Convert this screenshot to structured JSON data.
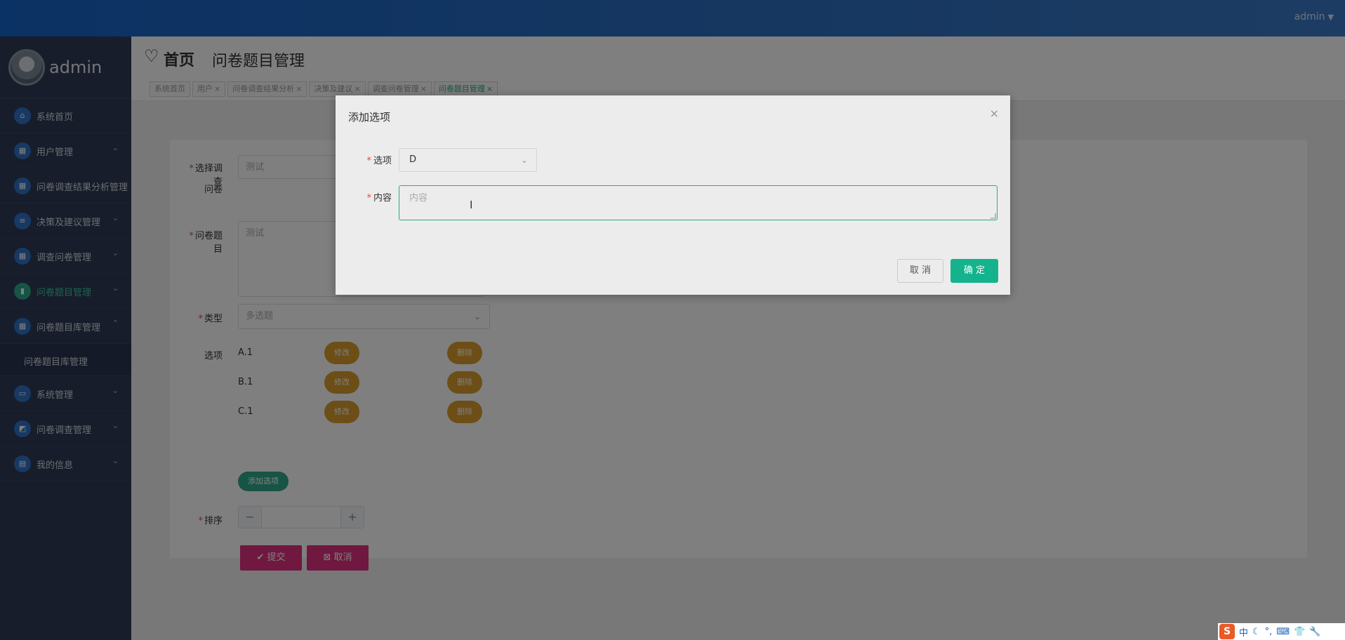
{
  "topbar": {
    "user": "admin",
    "caret": "▼"
  },
  "sidebar": {
    "brand": "admin",
    "items": [
      {
        "label": "系统首页",
        "icon": "home-icon",
        "glyph": "⌂",
        "arrow": ""
      },
      {
        "label": "用户管理",
        "icon": "grid-icon",
        "glyph": "▦",
        "arrow": "⌄"
      },
      {
        "label": "问卷调查结果分析管理",
        "icon": "grid-icon",
        "glyph": "▦",
        "arrow": ""
      },
      {
        "label": "决策及建议管理",
        "icon": "sliders-icon",
        "glyph": "≡",
        "arrow": "⌄"
      },
      {
        "label": "调查问卷管理",
        "icon": "grid-icon",
        "glyph": "▦",
        "arrow": "⌄"
      },
      {
        "label": "问卷题目管理",
        "icon": "book-icon",
        "glyph": "▮",
        "arrow": "⌄"
      },
      {
        "label": "问卷题目库管理",
        "icon": "grid-icon",
        "glyph": "▦",
        "arrow": "⌃"
      }
    ],
    "subitem": "问卷题目库管理",
    "items2": [
      {
        "label": "系统管理",
        "icon": "monitor-icon",
        "glyph": "▭",
        "arrow": "⌄"
      },
      {
        "label": "问卷调查管理",
        "icon": "inbox-icon",
        "glyph": "◩",
        "arrow": "⌄"
      },
      {
        "label": "我的信息",
        "icon": "card-icon",
        "glyph": "▤",
        "arrow": "⌄"
      }
    ]
  },
  "header": {
    "home": "首页",
    "title": "问卷题目管理",
    "tabs": [
      {
        "label": "系统首页",
        "close": ""
      },
      {
        "label": "用户",
        "close": "×"
      },
      {
        "label": "问卷调查结果分析",
        "close": "×"
      },
      {
        "label": "决策及建议",
        "close": "×"
      },
      {
        "label": "调查问卷管理",
        "close": "×"
      },
      {
        "label": "问卷题目管理",
        "close": "×"
      }
    ]
  },
  "form": {
    "survey_label_1": "选择调查",
    "survey_label_2": "问卷",
    "survey_value": "测试",
    "question_label": "问卷题目",
    "question_value": "测试",
    "type_label": "类型",
    "type_value": "多选题",
    "options_label": "选项",
    "options": [
      {
        "text": "A.1",
        "edit": "修改",
        "del": "删除"
      },
      {
        "text": "B.1",
        "edit": "修改",
        "del": "删除"
      },
      {
        "text": "C.1",
        "edit": "修改",
        "del": "删除"
      }
    ],
    "add_option": "添加选项",
    "sort_label": "排序",
    "minus": "−",
    "plus": "+",
    "submit": "✔ 提交",
    "cancel": "⊠ 取消"
  },
  "dialog": {
    "title": "添加选项",
    "close": "×",
    "option_label": "选项",
    "option_value": "D",
    "content_label": "内容",
    "content_placeholder": "内容",
    "cancel": "取 消",
    "confirm": "确 定"
  },
  "tray": [
    "中",
    "☾",
    "°,",
    "⌨",
    "👕",
    "🔧"
  ],
  "colors": {
    "accent": "#2ea88a",
    "primary": "#14b38d",
    "sidebar": "#2e3a55",
    "topbar": "#1764c9",
    "pink": "#e0307f",
    "orange": "#d99c2c"
  }
}
